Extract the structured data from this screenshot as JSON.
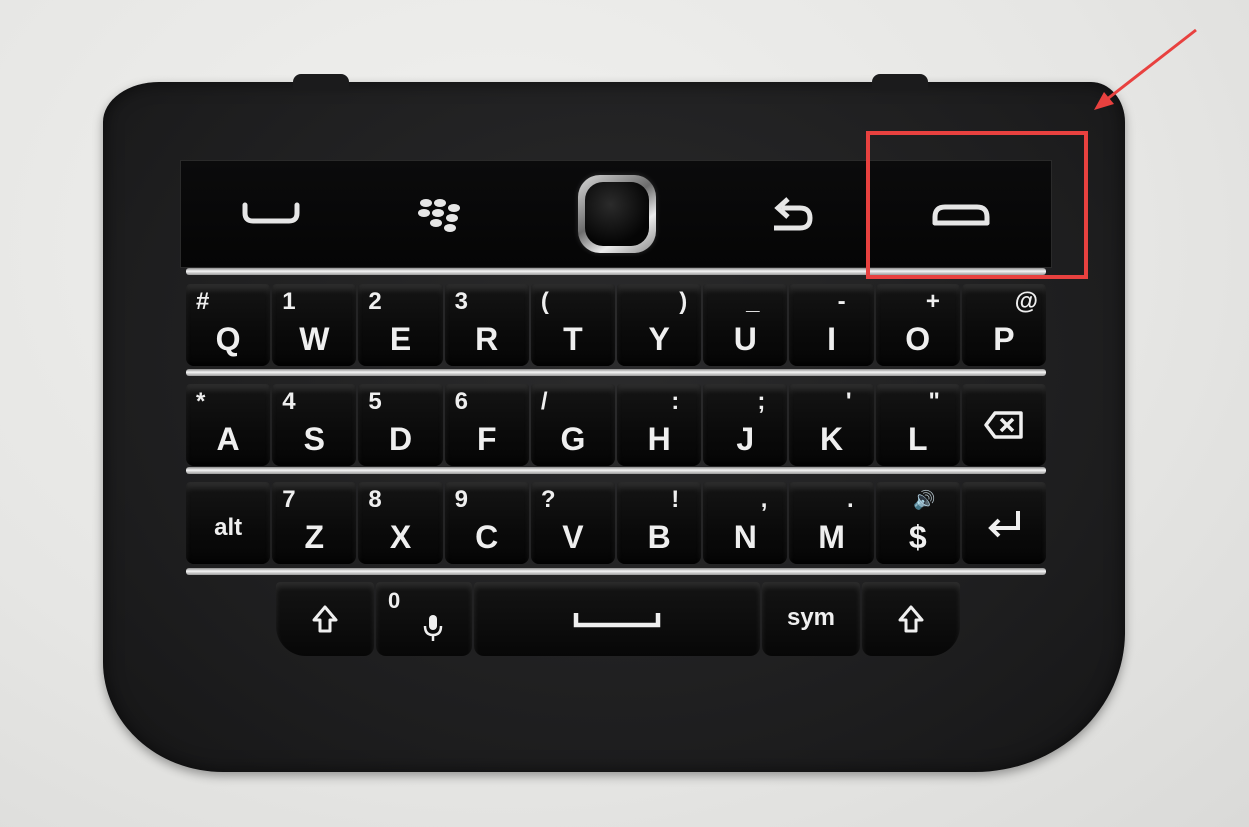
{
  "colors": {
    "highlight": "#e8413f",
    "key_text": "#efefef",
    "device_body": "#1d1d1e"
  },
  "navbar": {
    "keys": [
      {
        "icon": "call-icon"
      },
      {
        "icon": "blackberry-logo-icon"
      },
      {
        "icon": "trackpad"
      },
      {
        "icon": "back-icon"
      },
      {
        "icon": "end-call-icon"
      }
    ]
  },
  "rows": [
    [
      {
        "alt": "#",
        "main": "Q"
      },
      {
        "alt": "1",
        "main": "W"
      },
      {
        "alt": "2",
        "main": "E"
      },
      {
        "alt": "3",
        "main": "R"
      },
      {
        "alt": "(",
        "main": "T"
      },
      {
        "alt": ")",
        "main": "Y"
      },
      {
        "alt": "_",
        "main": "U"
      },
      {
        "alt": "-",
        "main": "I"
      },
      {
        "alt": "+",
        "main": "O"
      },
      {
        "alt": "@",
        "main": "P"
      }
    ],
    [
      {
        "alt": "*",
        "main": "A"
      },
      {
        "alt": "4",
        "main": "S"
      },
      {
        "alt": "5",
        "main": "D"
      },
      {
        "alt": "6",
        "main": "F"
      },
      {
        "alt": "/",
        "main": "G"
      },
      {
        "alt": ":",
        "main": "H"
      },
      {
        "alt": ";",
        "main": "J"
      },
      {
        "alt": "'",
        "main": "K"
      },
      {
        "alt": "\"",
        "main": "L"
      },
      {
        "alt": "",
        "main": "",
        "icon": "backspace-icon"
      }
    ],
    [
      {
        "alt": "",
        "main": "alt"
      },
      {
        "alt": "7",
        "main": "Z"
      },
      {
        "alt": "8",
        "main": "X"
      },
      {
        "alt": "9",
        "main": "C"
      },
      {
        "alt": "?",
        "main": "V"
      },
      {
        "alt": "!",
        "main": "B"
      },
      {
        "alt": ",",
        "main": "N"
      },
      {
        "alt": ".",
        "main": "M"
      },
      {
        "alt": "🔊",
        "main": "$"
      },
      {
        "alt": "",
        "main": "",
        "icon": "enter-icon"
      }
    ]
  ],
  "bottom": {
    "mic_alt": "0",
    "sym": "sym"
  }
}
